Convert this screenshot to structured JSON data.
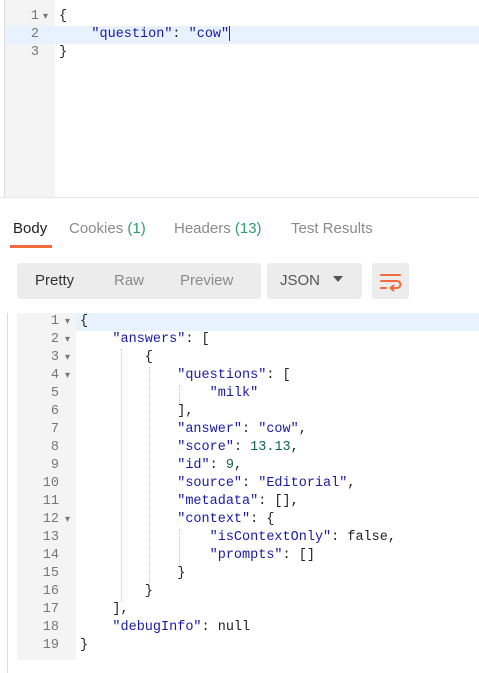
{
  "request": {
    "lines": [
      {
        "n": "1",
        "fold": true,
        "tokens": [
          {
            "t": "{",
            "c": "pun"
          }
        ]
      },
      {
        "n": "2",
        "fold": false,
        "tokens": [
          {
            "t": "    \"question\"",
            "c": "key"
          },
          {
            "t": ": ",
            "c": "pun"
          },
          {
            "t": "\"cow\"",
            "c": "str"
          }
        ]
      },
      {
        "n": "3",
        "fold": false,
        "tokens": [
          {
            "t": "}",
            "c": "pun"
          }
        ]
      }
    ]
  },
  "tabs": [
    {
      "label": "Body",
      "count": "",
      "active": true
    },
    {
      "label": "Cookies",
      "count": "(1)",
      "active": false
    },
    {
      "label": "Headers",
      "count": "(13)",
      "active": false
    },
    {
      "label": "Test Results",
      "count": "",
      "active": false
    }
  ],
  "toolbar": {
    "views": [
      "Pretty",
      "Raw",
      "Preview"
    ],
    "active_view": "Pretty",
    "format": "JSON",
    "wrap_icon": "wrap-lines-icon",
    "accent_color": "#f26b3a"
  },
  "response": {
    "lines": [
      {
        "n": "1",
        "fold": true,
        "tokens": [
          {
            "t": "{",
            "c": "pun"
          }
        ]
      },
      {
        "n": "2",
        "fold": true,
        "tokens": [
          {
            "t": "    \"answers\"",
            "c": "key"
          },
          {
            "t": ": [",
            "c": "pun"
          }
        ]
      },
      {
        "n": "3",
        "fold": true,
        "tokens": [
          {
            "t": "        {",
            "c": "pun"
          }
        ]
      },
      {
        "n": "4",
        "fold": true,
        "tokens": [
          {
            "t": "            \"questions\"",
            "c": "key"
          },
          {
            "t": ": [",
            "c": "pun"
          }
        ]
      },
      {
        "n": "5",
        "fold": false,
        "tokens": [
          {
            "t": "                \"milk\"",
            "c": "str"
          }
        ]
      },
      {
        "n": "6",
        "fold": false,
        "tokens": [
          {
            "t": "            ],",
            "c": "pun"
          }
        ]
      },
      {
        "n": "7",
        "fold": false,
        "tokens": [
          {
            "t": "            \"answer\"",
            "c": "key"
          },
          {
            "t": ": ",
            "c": "pun"
          },
          {
            "t": "\"cow\"",
            "c": "str"
          },
          {
            "t": ",",
            "c": "pun"
          }
        ]
      },
      {
        "n": "8",
        "fold": false,
        "tokens": [
          {
            "t": "            \"score\"",
            "c": "key"
          },
          {
            "t": ": ",
            "c": "pun"
          },
          {
            "t": "13.13",
            "c": "num"
          },
          {
            "t": ",",
            "c": "pun"
          }
        ]
      },
      {
        "n": "9",
        "fold": false,
        "tokens": [
          {
            "t": "            \"id\"",
            "c": "key"
          },
          {
            "t": ": ",
            "c": "pun"
          },
          {
            "t": "9",
            "c": "num"
          },
          {
            "t": ",",
            "c": "pun"
          }
        ]
      },
      {
        "n": "10",
        "fold": false,
        "tokens": [
          {
            "t": "            \"source\"",
            "c": "key"
          },
          {
            "t": ": ",
            "c": "pun"
          },
          {
            "t": "\"Editorial\"",
            "c": "str"
          },
          {
            "t": ",",
            "c": "pun"
          }
        ]
      },
      {
        "n": "11",
        "fold": false,
        "tokens": [
          {
            "t": "            \"metadata\"",
            "c": "key"
          },
          {
            "t": ": [],",
            "c": "pun"
          }
        ]
      },
      {
        "n": "12",
        "fold": true,
        "tokens": [
          {
            "t": "            \"context\"",
            "c": "key"
          },
          {
            "t": ": {",
            "c": "pun"
          }
        ]
      },
      {
        "n": "13",
        "fold": false,
        "tokens": [
          {
            "t": "                \"isContextOnly\"",
            "c": "key"
          },
          {
            "t": ": ",
            "c": "pun"
          },
          {
            "t": "false",
            "c": "kw"
          },
          {
            "t": ",",
            "c": "pun"
          }
        ]
      },
      {
        "n": "14",
        "fold": false,
        "tokens": [
          {
            "t": "                \"prompts\"",
            "c": "key"
          },
          {
            "t": ": []",
            "c": "pun"
          }
        ]
      },
      {
        "n": "15",
        "fold": false,
        "tokens": [
          {
            "t": "            }",
            "c": "pun"
          }
        ]
      },
      {
        "n": "16",
        "fold": false,
        "tokens": [
          {
            "t": "        }",
            "c": "pun"
          }
        ]
      },
      {
        "n": "17",
        "fold": false,
        "tokens": [
          {
            "t": "    ],",
            "c": "pun"
          }
        ]
      },
      {
        "n": "18",
        "fold": false,
        "tokens": [
          {
            "t": "    \"debugInfo\"",
            "c": "key"
          },
          {
            "t": ": ",
            "c": "pun"
          },
          {
            "t": "null",
            "c": "kw"
          }
        ]
      },
      {
        "n": "19",
        "fold": false,
        "tokens": [
          {
            "t": "}",
            "c": "pun"
          }
        ]
      }
    ]
  }
}
